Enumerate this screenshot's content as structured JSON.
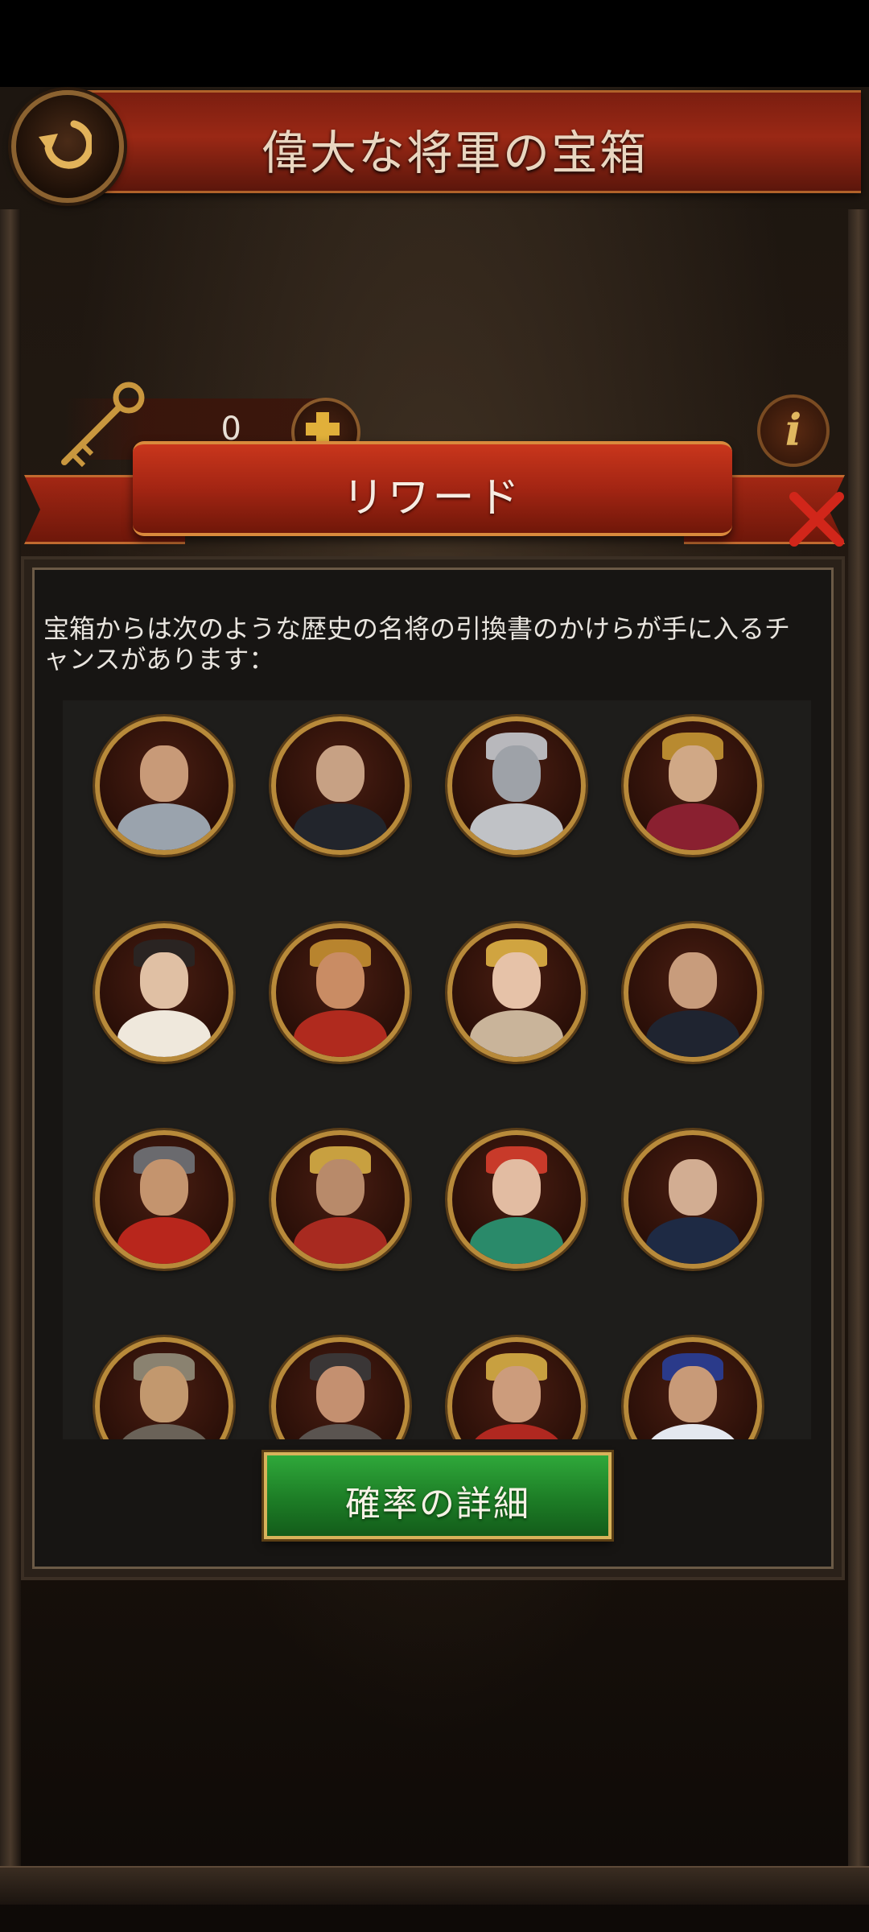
{
  "header": {
    "title": "偉大な将軍の宝箱",
    "back_icon": "back-arrow-icon"
  },
  "resource": {
    "key_count": "0",
    "key_icon": "key-icon",
    "add_icon": "plus-icon"
  },
  "info_glyph": "i",
  "dialog": {
    "title": "リワード",
    "description": "宝箱からは次のような歴史の名将の引換書のかけらが手に入るチャンスがあります：",
    "details_button": "確率の詳細",
    "close_icon": "close-icon"
  },
  "portrait_colors": {
    "border": "#b88a3a",
    "panel": "#171513",
    "button_green": "#1d7d26",
    "ribbon_red": "#a32513"
  }
}
